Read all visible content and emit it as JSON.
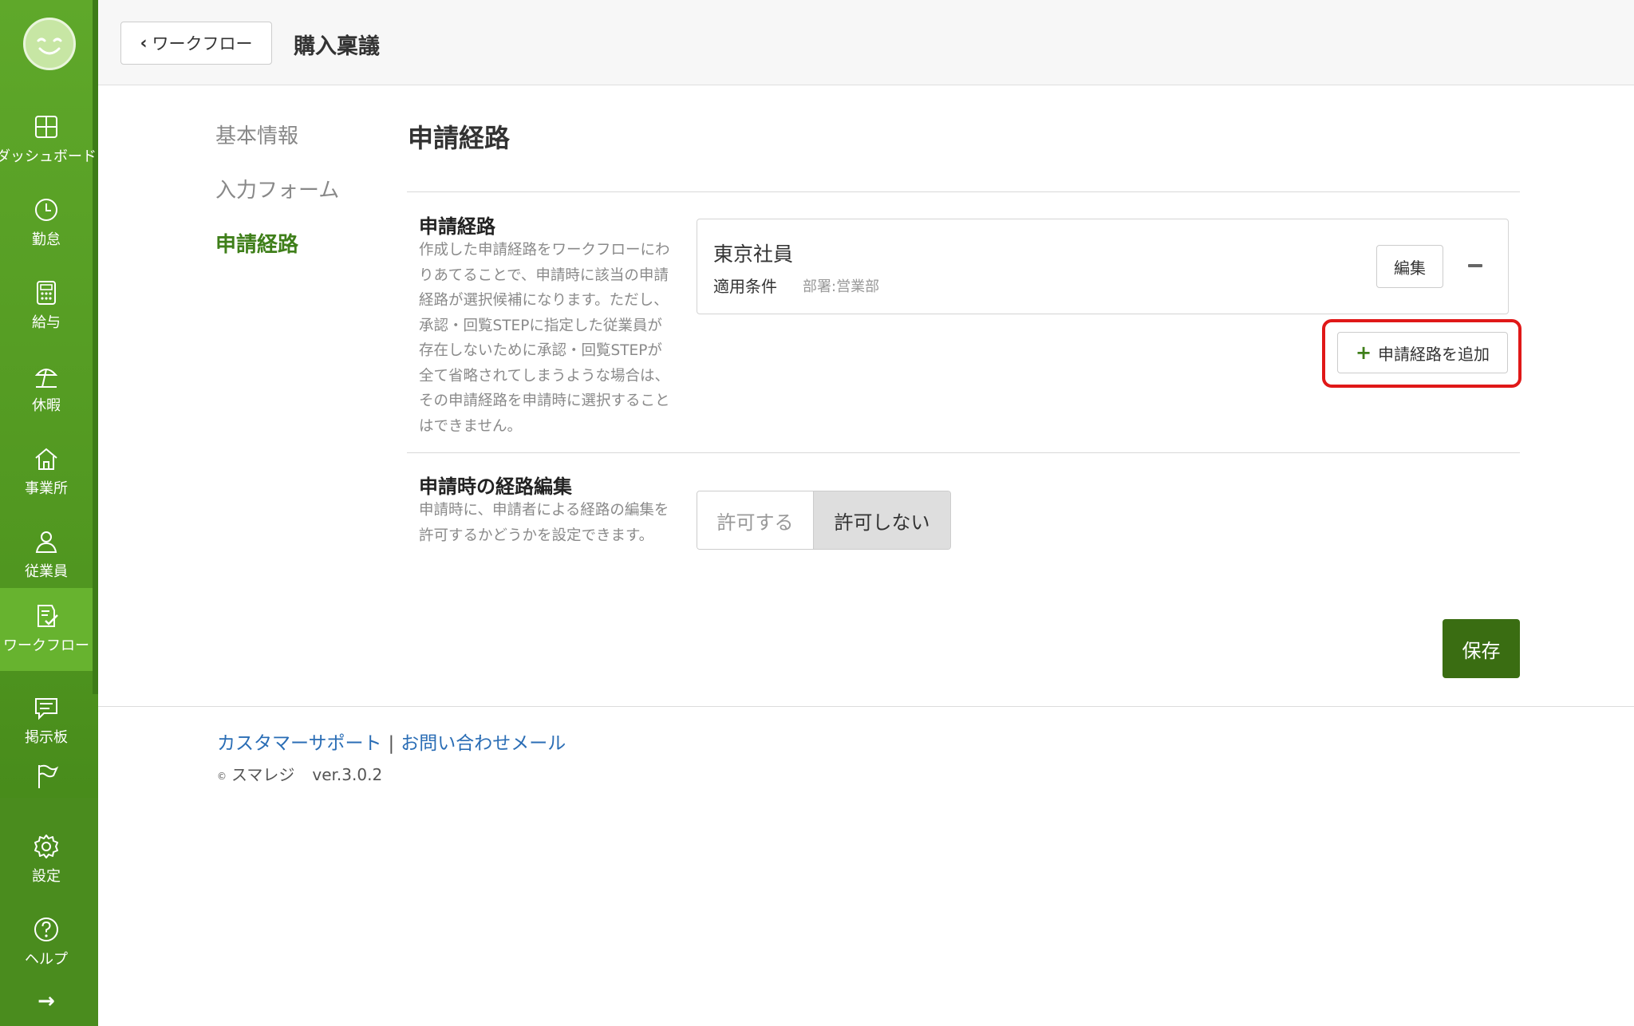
{
  "sidebar": {
    "items": [
      {
        "label": "ダッシュボード"
      },
      {
        "label": "勤怠"
      },
      {
        "label": "給与"
      },
      {
        "label": "休暇"
      },
      {
        "label": "事業所"
      },
      {
        "label": "従業員"
      },
      {
        "label": "ワークフロー"
      },
      {
        "label": "掲示板"
      },
      {
        "label": ""
      },
      {
        "label": "設定"
      },
      {
        "label": "ヘルプ"
      }
    ],
    "active_index": 6,
    "expand_glyph": "→"
  },
  "header": {
    "back_label": "ワークフロー",
    "title": "購入稟議"
  },
  "subnav": {
    "items": [
      {
        "label": "基本情報"
      },
      {
        "label": "入力フォーム"
      },
      {
        "label": "申請経路"
      }
    ],
    "active_index": 2
  },
  "main": {
    "section_title": "申請経路",
    "route_row": {
      "title": "申請経路",
      "description": "作成した申請経路をワークフローにわりあてることで、申請時に該当の申請経路が選択候補になります。ただし、承認・回覧STEPに指定した従業員が存在しないために承認・回覧STEPが全て省略されてしまうような場合は、その申請経路を申請時に選択することはできません。",
      "card": {
        "name": "東京社員",
        "condition_label": "適用条件",
        "condition_value": "部署:営業部",
        "edit_label": "編集"
      },
      "add_label": "申請経路を追加"
    },
    "edit_row": {
      "title": "申請時の経路編集",
      "description": "申請時に、申請者による経路の編集を許可するかどうかを設定できます。",
      "options": [
        "許可する",
        "許可しない"
      ],
      "selected": "許可しない"
    },
    "save_label": "保存"
  },
  "footer": {
    "support_link": "カスタマーサポート",
    "separator": "|",
    "mail_link": "お問い合わせメール",
    "copyright_mark": "©",
    "company": "スマレジ",
    "version": "ver.3.0.2"
  },
  "colors": {
    "brand_green": "#5fa82a",
    "save_green": "#3a6d12",
    "highlight_red": "#e01818",
    "link_blue": "#2a6db5"
  }
}
